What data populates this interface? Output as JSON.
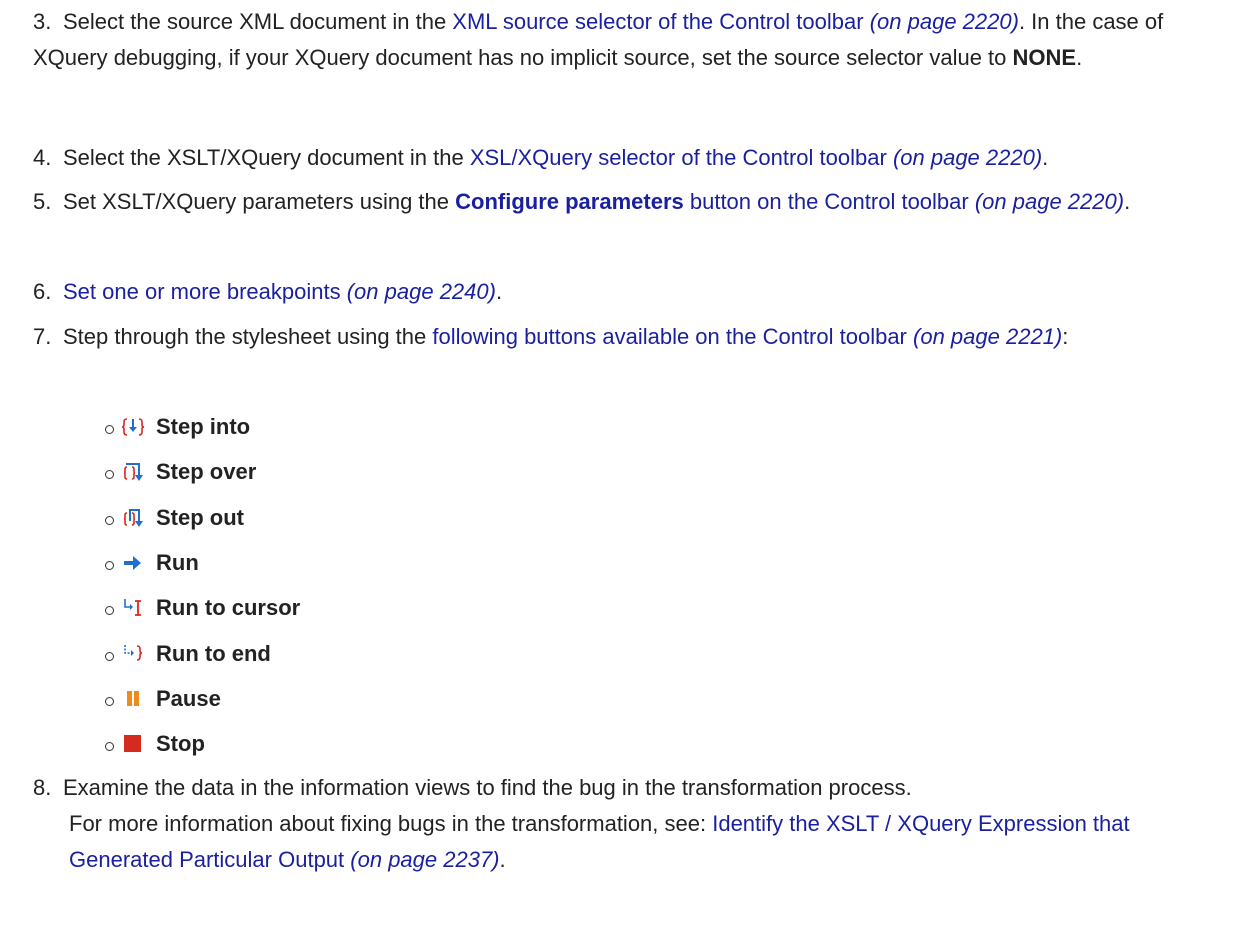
{
  "colors": {
    "link": "#1a1fa0",
    "text": "#222222",
    "icon_blue": "#1f6fd0",
    "icon_red": "#d62a1f",
    "icon_orange": "#f08a1a"
  },
  "steps": [
    {
      "num": "3.",
      "t1": "Select the source XML document in the ",
      "link": "XML source selector of the Control toolbar",
      "page": "(on page 2220)",
      "t2": ". In the case of XQuery debugging, if your XQuery document has no implicit source, set the source selector value to ",
      "bold": "NONE",
      "t3": "."
    },
    {
      "num": "4.",
      "t1": "Select the XSLT/XQuery document in the ",
      "link": "XSL/XQuery selector of the Control toolbar",
      "page": "(on page 2220)",
      "t2": "."
    },
    {
      "num": "5.",
      "t1": "Set XSLT/XQuery parameters using the ",
      "link_bold": "Configure parameters",
      "link": " button on the Control toolbar",
      "page": "(on page 2220)",
      "t2": "."
    },
    {
      "num": "6.",
      "link": "Set one or more breakpoints",
      "page": "(on page 2240)",
      "t2": "."
    },
    {
      "num": "7.",
      "t1": "Step through the stylesheet using the ",
      "link": "following buttons available on the Control toolbar",
      "page": "(on page 2221)",
      "t2": ":"
    },
    {
      "num": "8.",
      "t1": "Examine the data in the information views to find the bug in the transformation process.",
      "t2": "For more information about fixing bugs in the transformation, see: ",
      "link": "Identify the XSLT / XQuery Expression that Generated Particular Output",
      "page": "(on page 2237)",
      "t3": "."
    }
  ],
  "buttons": [
    {
      "label": "Step into",
      "icon": "step-into-icon"
    },
    {
      "label": "Step over",
      "icon": "step-over-icon"
    },
    {
      "label": "Step out",
      "icon": "step-out-icon"
    },
    {
      "label": "Run",
      "icon": "run-icon"
    },
    {
      "label": "Run to cursor",
      "icon": "run-to-cursor-icon"
    },
    {
      "label": "Run to end",
      "icon": "run-to-end-icon"
    },
    {
      "label": "Pause",
      "icon": "pause-icon"
    },
    {
      "label": "Stop",
      "icon": "stop-icon"
    }
  ]
}
